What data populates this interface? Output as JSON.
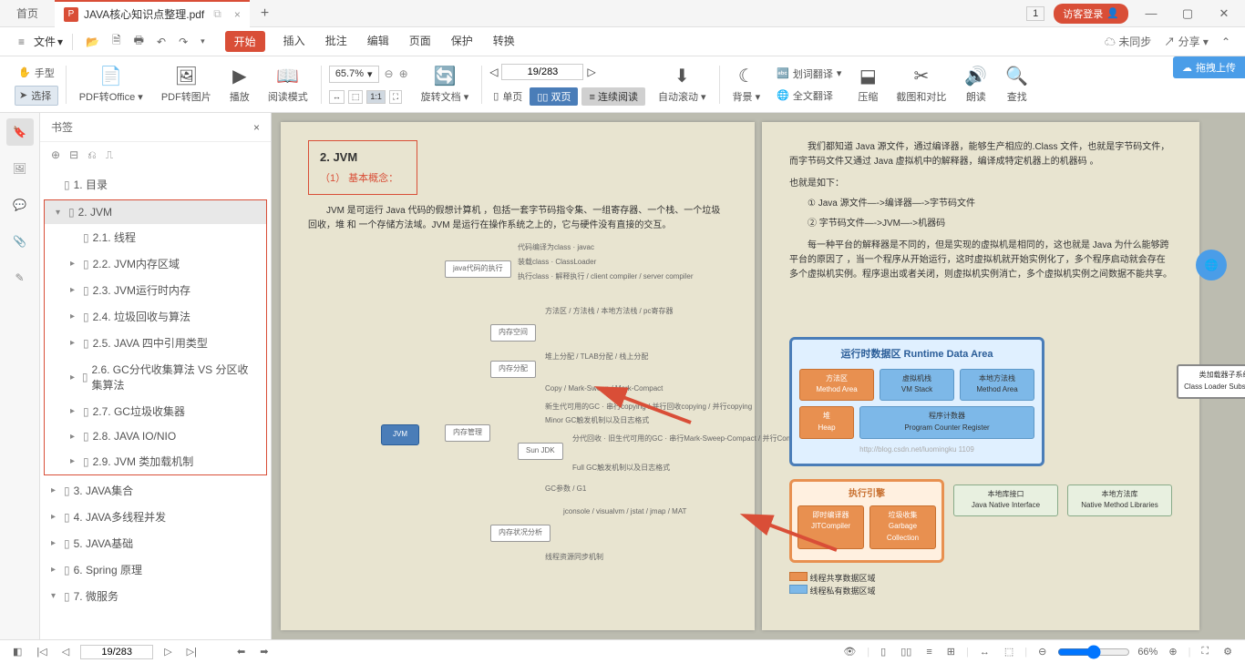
{
  "titlebar": {
    "home": "首页",
    "filename": "JAVA核心知识点整理.pdf",
    "count": "1",
    "login": "访客登录"
  },
  "menubar": {
    "file": "文件",
    "tabs": [
      "开始",
      "插入",
      "批注",
      "编辑",
      "页面",
      "保护",
      "转换"
    ],
    "unsync": "未同步",
    "share": "分享"
  },
  "toolbar": {
    "hand": "手型",
    "select": "选择",
    "pdf_office": "PDF转Office",
    "pdf_image": "PDF转图片",
    "play": "播放",
    "read_mode": "阅读模式",
    "zoom": "65.7%",
    "rotate": "旋转文档",
    "single": "单页",
    "double": "双页",
    "continuous": "连续阅读",
    "autoscroll": "自动滚动",
    "background": "背景",
    "translate_select": "划词翻译",
    "translate_full": "全文翻译",
    "compress": "压缩",
    "crop": "截图和对比",
    "read_aloud": "朗读",
    "find": "查找",
    "page_current": "19",
    "page_total": "/283",
    "drag_upload": "拖拽上传"
  },
  "bookmarks": {
    "title": "书签",
    "items": [
      {
        "label": "1. 目录",
        "indent": 0,
        "arrow": "▸"
      },
      {
        "label": "2. JVM",
        "indent": 0,
        "arrow": "▾",
        "hl": true
      },
      {
        "label": "2.1. 线程",
        "indent": 1
      },
      {
        "label": "2.2. JVM内存区域",
        "indent": 1,
        "arrow": "▸"
      },
      {
        "label": "2.3. JVM运行时内存",
        "indent": 1,
        "arrow": "▸"
      },
      {
        "label": "2.4. 垃圾回收与算法",
        "indent": 1,
        "arrow": "▸"
      },
      {
        "label": "2.5. JAVA 四中引用类型",
        "indent": 1,
        "arrow": "▸"
      },
      {
        "label": "2.6. GC分代收集算法  VS 分区收集算法",
        "indent": 1,
        "arrow": "▸"
      },
      {
        "label": "2.7. GC垃圾收集器",
        "indent": 1,
        "arrow": "▸"
      },
      {
        "label": "2.8.  JAVA IO/NIO",
        "indent": 1,
        "arrow": "▸"
      },
      {
        "label": "2.9. JVM 类加载机制",
        "indent": 1,
        "arrow": "▸"
      },
      {
        "label": "3. JAVA集合",
        "indent": 0,
        "arrow": "▸"
      },
      {
        "label": "4. JAVA多线程并发",
        "indent": 0,
        "arrow": "▸"
      },
      {
        "label": "5. JAVA基础",
        "indent": 0,
        "arrow": "▸"
      },
      {
        "label": "6. Spring 原理",
        "indent": 0,
        "arrow": "▸"
      },
      {
        "label": "7.  微服务",
        "indent": 0,
        "arrow": "▾"
      }
    ]
  },
  "doc": {
    "title": "2. JVM",
    "subtitle": "（1） 基本概念：",
    "para1": "JVM 是可运行 Java 代码的假想计算机 ，包括一套字节码指令集、一组寄存器、一个栈、一个垃圾回收，堆 和 一个存储方法域。JVM 是运行在操作系统之上的，它与硬件没有直接的交互。",
    "para2": "我们都知道 Java 源文件，通过编译器，能够生产相应的.Class 文件，也就是字节码文件，而字节码文件又通过 Java 虚拟机中的解释器，编译成特定机器上的机器码 。",
    "also": "也就是如下：",
    "step1": "① Java 源文件—->编译器—->字节码文件",
    "step2": "② 字节码文件—->JVM—->机器码",
    "para3": "每一种平台的解释器是不同的，但是实现的虚拟机是相同的，这也就是 Java 为什么能够跨平台的原因了 ，当一个程序从开始运行，这时虚拟机就开始实例化了，多个程序启动就会存在多个虚拟机实例。程序退出或者关闭，则虚拟机实例消亡，多个虚拟机实例之间数据不能共享。",
    "mm_root": "JVM",
    "mm_code": "java代码的执行",
    "mm_mem": "内存管理",
    "runtime_title": "运行时数据区  Runtime Data Area",
    "method_area": "方法区\nMethod Area",
    "vm_stack": "虚拟机栈\nVM Stack",
    "native_stack": "本地方法栈\nMethod Area",
    "heap": "堆\nHeap",
    "pc": "程序计数器\nProgram Counter Register",
    "exec_title": "执行引擎",
    "jit": "即时编译器\nJITCompiler",
    "gc": "垃圾收集\nGarbage Collection",
    "jni": "本地库接口\nJava Native Interface",
    "nml": "本地方法库\nNative Method Libraries",
    "cls": "类加载器子系统\nClass Loader Subsystem",
    "shared": "线程共享数据区域",
    "private": "线程私有数据区域",
    "watermark": "http://blog.csdn.net/luomingku 1109"
  },
  "bottombar": {
    "page_current": "19",
    "page_total": "/283",
    "zoom": "66%"
  }
}
